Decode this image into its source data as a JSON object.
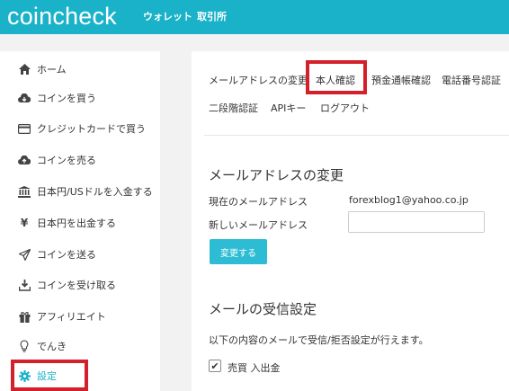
{
  "header": {
    "logo": "coincheck",
    "nav": [
      "ウォレット",
      "取引所"
    ]
  },
  "sidebar": {
    "items": [
      {
        "label": "ホーム",
        "icon": "home-icon"
      },
      {
        "label": "コインを買う",
        "icon": "cloud-download-icon"
      },
      {
        "label": "クレジットカードで買う",
        "icon": "credit-card-icon"
      },
      {
        "label": "コインを売る",
        "icon": "cloud-upload-icon"
      },
      {
        "label": "日本円/USドルを入金する",
        "icon": "bank-icon"
      },
      {
        "label": "日本円を出金する",
        "icon": "yen-icon"
      },
      {
        "label": "コインを送る",
        "icon": "send-icon"
      },
      {
        "label": "コインを受け取る",
        "icon": "download-icon"
      },
      {
        "label": "アフィリエイト",
        "icon": "gift-icon"
      },
      {
        "label": "でんき",
        "icon": "lightbulb-icon"
      },
      {
        "label": "設定",
        "icon": "gear-icon"
      }
    ]
  },
  "tabs": [
    "メールアドレスの変更",
    "本人確認",
    "預金通帳確認",
    "電話番号認証",
    "二段階認証",
    "APIキー",
    "ログアウト"
  ],
  "email_section": {
    "title": "メールアドレスの変更",
    "current_label": "現在のメールアドレス",
    "current_value": "forexblog1@yahoo.co.jp",
    "new_label": "新しいメールアドレス",
    "new_value": "",
    "submit_label": "変更する"
  },
  "receive_section": {
    "title": "メールの受信設定",
    "description": "以下の内容のメールで受信/拒否設定が行えます。",
    "checkbox_label": "売買 入出金",
    "checkbox_checked": true
  },
  "colors": {
    "accent": "#1ab2c8",
    "highlight": "#d4202a"
  }
}
